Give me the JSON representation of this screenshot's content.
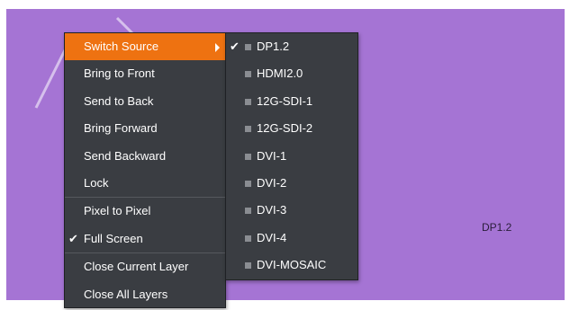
{
  "layer": {
    "label": "DP1.2"
  },
  "context_menu": {
    "items": [
      {
        "label": "Switch Source"
      },
      {
        "label": "Bring to Front"
      },
      {
        "label": "Send to Back"
      },
      {
        "label": "Bring Forward"
      },
      {
        "label": "Send Backward"
      },
      {
        "label": "Lock"
      },
      {
        "label": "Pixel to Pixel"
      },
      {
        "label": "Full Screen",
        "check": "✔"
      },
      {
        "label": "Close Current Layer"
      },
      {
        "label": "Close All Layers"
      }
    ]
  },
  "source_menu": {
    "items": [
      {
        "label": "DP1.2",
        "check": "✔"
      },
      {
        "label": "HDMI2.0"
      },
      {
        "label": "12G-SDI-1"
      },
      {
        "label": "12G-SDI-2"
      },
      {
        "label": "DVI-1"
      },
      {
        "label": "DVI-2"
      },
      {
        "label": "DVI-3"
      },
      {
        "label": "DVI-4"
      },
      {
        "label": "DVI-MOSAIC"
      }
    ]
  },
  "colors": {
    "layer_bg": "#a574d4",
    "menu_bg": "#3a3d42",
    "highlight": "#ee7211"
  }
}
